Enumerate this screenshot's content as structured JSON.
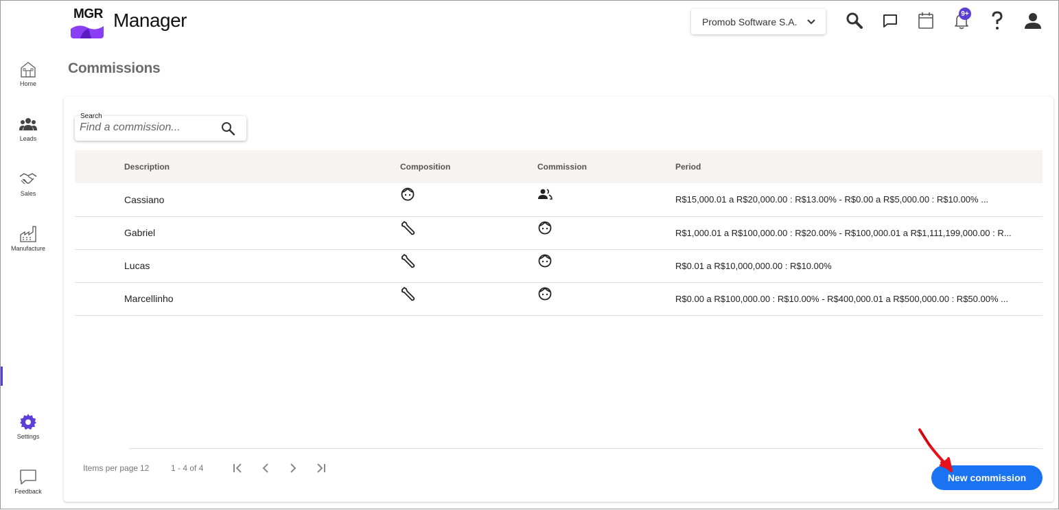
{
  "header": {
    "logo_text": "MGR",
    "app_title": "Manager",
    "company": "Promob Software S.A.",
    "notification_badge": "9+"
  },
  "sidebar": {
    "items": [
      {
        "label": "Home",
        "icon": "home-icon"
      },
      {
        "label": "Leads",
        "icon": "people-icon"
      },
      {
        "label": "Sales",
        "icon": "handshake-icon"
      },
      {
        "label": "Manufacture",
        "icon": "factory-icon"
      },
      {
        "label": "Settings",
        "icon": "gear-icon"
      },
      {
        "label": "Feedback",
        "icon": "chat-icon"
      }
    ],
    "active": "Settings"
  },
  "page": {
    "title": "Commissions"
  },
  "search": {
    "label": "Search",
    "placeholder": "Find a commission..."
  },
  "table": {
    "columns": [
      "Description",
      "Composition",
      "Commission",
      "Period"
    ],
    "rows": [
      {
        "description": "Cassiano",
        "composition_icon": "face-icon",
        "commission_icon": "group-icon",
        "period": "R$15,000.01 a R$20,000.00 : R$13.00% - R$0.00 a R$5,000.00 : R$10.00% ..."
      },
      {
        "description": "Gabriel",
        "composition_icon": "wrench-icon",
        "commission_icon": "face-icon",
        "period": "R$1,000.01 a R$100,000.00 : R$20.00% - R$100,000.01 a R$1,111,199,000.00 : R..."
      },
      {
        "description": "Lucas",
        "composition_icon": "wrench-icon",
        "commission_icon": "face-icon",
        "period": "R$0.01 a R$10,000,000.00 : R$10.00%"
      },
      {
        "description": "Marcellinho",
        "composition_icon": "wrench-icon",
        "commission_icon": "face-icon",
        "period": "R$0.00 a R$100,000.00 : R$10.00% - R$400,000.01 a R$500,000.00 : R$50.00% ..."
      }
    ]
  },
  "pagination": {
    "items_per_page_label": "Items per page",
    "items_per_page": "12",
    "range": "1 - 4 of 4"
  },
  "actions": {
    "new_commission": "New commission"
  },
  "colors": {
    "accent_purple": "#5b3fd6",
    "primary_button": "#1a73f0",
    "header_row_bg": "#f7f3f0",
    "annotation_arrow": "#e8101a"
  }
}
